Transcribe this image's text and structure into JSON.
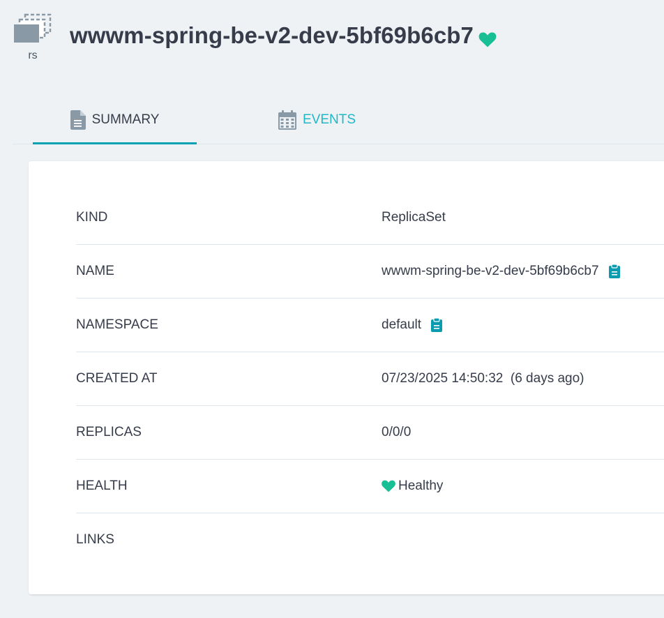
{
  "header": {
    "kind_abbr": "rs",
    "title": "wwwm-spring-be-v2-dev-5bf69b6cb7",
    "health_icon": "heart-icon",
    "health_color": "#18be94"
  },
  "tabs": [
    {
      "label": "SUMMARY",
      "icon": "file-icon",
      "active": true
    },
    {
      "label": "EVENTS",
      "icon": "calendar-icon",
      "active": false
    }
  ],
  "summary": {
    "rows": [
      {
        "label": "KIND",
        "value": "ReplicaSet"
      },
      {
        "label": "NAME",
        "value": "wwwm-spring-be-v2-dev-5bf69b6cb7",
        "copy_icon": "clipboard-icon"
      },
      {
        "label": "NAMESPACE",
        "value": "default",
        "copy_icon": "clipboard-icon"
      },
      {
        "label": "CREATED AT",
        "value": "07/23/2025 14:50:32  (6 days ago)"
      },
      {
        "label": "REPLICAS",
        "value": "0/0/0"
      },
      {
        "label": "HEALTH",
        "value": "Healthy",
        "icon": "heart-icon"
      },
      {
        "label": "LINKS",
        "value": ""
      }
    ]
  },
  "colors": {
    "accent": "#00a2b3",
    "tab_inactive": "#20b8c7",
    "healthy": "#18be94",
    "copy": "#0a9bb0"
  }
}
